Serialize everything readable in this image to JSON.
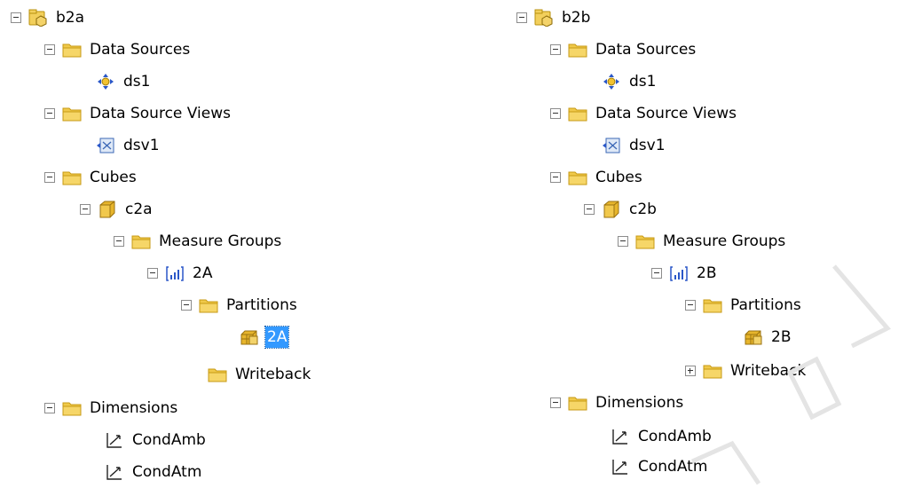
{
  "left_tree": {
    "project": "b2a",
    "data_sources_folder": "Data Sources",
    "data_source": "ds1",
    "dsv_folder": "Data Source Views",
    "dsv": "dsv1",
    "cubes_folder": "Cubes",
    "cube": "c2a",
    "measure_groups_folder": "Measure Groups",
    "measure_group": "2A",
    "partitions_folder": "Partitions",
    "partition": "2A",
    "writeback_folder": "Writeback",
    "dimensions_folder": "Dimensions",
    "dimension_1": "CondAmb",
    "dimension_2": "CondAtm"
  },
  "right_tree": {
    "project": "b2b",
    "data_sources_folder": "Data Sources",
    "data_source": "ds1",
    "dsv_folder": "Data Source Views",
    "dsv": "dsv1",
    "cubes_folder": "Cubes",
    "cube": "c2b",
    "measure_groups_folder": "Measure Groups",
    "measure_group": "2B",
    "partitions_folder": "Partitions",
    "partition": "2B",
    "writeback_folder": "Writeback",
    "dimensions_folder": "Dimensions",
    "dimension_1": "CondAmb",
    "dimension_2": "CondAtm"
  },
  "selected_node": "left_tree.partition",
  "colors": {
    "selection": "#3399ff",
    "folder": "#e8c03a",
    "cube": "#e7b52c"
  },
  "icons": [
    "project-icon",
    "folder-icon",
    "data-source-icon",
    "dsv-icon",
    "cube-icon",
    "measure-group-icon",
    "partition-icon",
    "dimension-icon"
  ]
}
